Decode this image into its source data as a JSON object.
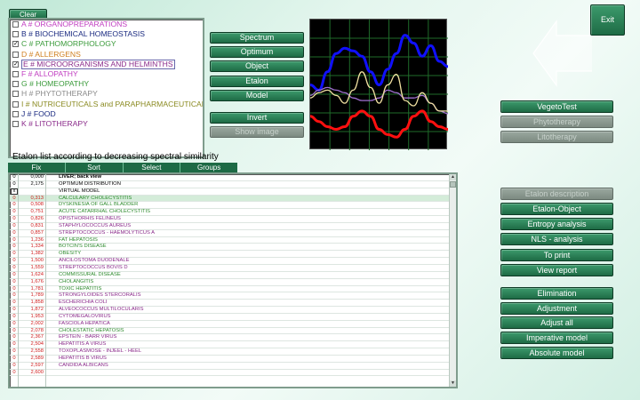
{
  "clear_label": "Clear",
  "exit_label": "Exit",
  "categories": [
    {
      "label": "A # ORGANOPREPARATIONS",
      "color": "#c03cc0",
      "checked": false
    },
    {
      "label": "B # BIOCHEMICAL HOMEOSTASIS",
      "color": "#1a2a80",
      "checked": false
    },
    {
      "label": "C # PATHOMORPHOLOGY",
      "color": "#3a9a3a",
      "checked": true
    },
    {
      "label": "D # ALLERGENS",
      "color": "#d08020",
      "checked": false
    },
    {
      "label": "E # MICROORGANISMS AND HELMINTHS",
      "color": "#8a2a8a",
      "checked": true
    },
    {
      "label": "F # ALLOPATHY",
      "color": "#c03cc0",
      "checked": false
    },
    {
      "label": "G # HOMEOPATHY",
      "color": "#3a9a3a",
      "checked": false
    },
    {
      "label": "H # PHYTOTHERAPY",
      "color": "#8a8a8a",
      "checked": false
    },
    {
      "label": "I # NUTRICEUTICALS and PARAPHARMACEUTICALS",
      "color": "#8a8a20",
      "checked": false
    },
    {
      "label": "J # FOOD",
      "color": "#1a2a80",
      "checked": false
    },
    {
      "label": "K # LITOTHERAPY",
      "color": "#8a2a8a",
      "checked": false
    }
  ],
  "middle_buttons": [
    {
      "name": "spectrum-button",
      "label": "Spectrum",
      "disabled": false
    },
    {
      "name": "optimum-button",
      "label": "Optimum",
      "disabled": false
    },
    {
      "name": "object-button",
      "label": "Object",
      "disabled": false
    },
    {
      "name": "etalon-button",
      "label": "Etalon",
      "disabled": false
    },
    {
      "name": "model-button",
      "label": "Model",
      "disabled": false
    },
    {
      "name": "invert-button",
      "label": "Invert",
      "disabled": false
    },
    {
      "name": "show-image-button",
      "label": "Show image",
      "disabled": true
    }
  ],
  "right_top_buttons": [
    {
      "name": "vegetotest-button",
      "label": "VegetoTest",
      "disabled": false
    },
    {
      "name": "phytotherapy-button",
      "label": "Phytotherapy",
      "disabled": true
    },
    {
      "name": "litotherapy-button",
      "label": "Litotherapy",
      "disabled": true
    }
  ],
  "right_mid_buttons": [
    {
      "name": "etalon-description-button",
      "label": "Etalon description",
      "disabled": true
    },
    {
      "name": "etalon-object-button",
      "label": "Etalon-Object",
      "disabled": false
    },
    {
      "name": "entropy-analysis-button",
      "label": "Entropy analysis",
      "disabled": false
    },
    {
      "name": "nls-analysis-button",
      "label": "NLS - analysis",
      "disabled": false
    },
    {
      "name": "to-print-button",
      "label": "To print",
      "disabled": false
    },
    {
      "name": "view-report-button",
      "label": "View report",
      "disabled": false
    }
  ],
  "right_bottom_buttons": [
    {
      "name": "elimination-button",
      "label": "Elimination",
      "disabled": false
    },
    {
      "name": "adjustment-button",
      "label": "Adjustment",
      "disabled": false
    },
    {
      "name": "adjust-all-button",
      "label": "Adjust all",
      "disabled": false
    },
    {
      "name": "imperative-model-button",
      "label": "Imperative model",
      "disabled": false
    },
    {
      "name": "absolute-model-button",
      "label": "Absolute model",
      "disabled": false
    }
  ],
  "list_title": "Etalon list according to decreasing spectral similarity",
  "list_toolbar": [
    "Fix",
    "Sort",
    "Select",
    "Groups"
  ],
  "list_rows": [
    {
      "chk": "0",
      "value": "0,000",
      "name": "LIVER; back view",
      "color": "#000000",
      "bold": true,
      "selected": false
    },
    {
      "chk": "0",
      "value": "2,175",
      "name": "OPTIMUM DISTRIBUTION",
      "color": "#000000",
      "bold": false,
      "selected": false
    },
    {
      "chk": "x",
      "value": "",
      "name": "VIRTUAL MODEL",
      "color": "#000000",
      "bold": false,
      "selected": false
    },
    {
      "chk": "0",
      "value": "0,313",
      "name": "CALCULARY CHOLECYSTITIS",
      "color": "#2e8b2e",
      "bold": false,
      "selected": true
    },
    {
      "chk": "0",
      "value": "0,508",
      "name": "DYSKINESIA OF GALL BLADDER",
      "color": "#2e8b2e",
      "bold": false,
      "selected": false
    },
    {
      "chk": "0",
      "value": "0,751",
      "name": "ACUTE CATARRHAL CHOLECYSTITIS",
      "color": "#2e8b2e",
      "bold": false,
      "selected": false
    },
    {
      "chk": "0",
      "value": "0,826",
      "name": "OPISTHORHIS FELINEUS",
      "color": "#8a2a8a",
      "bold": false,
      "selected": false
    },
    {
      "chk": "0",
      "value": "0,831",
      "name": "STAPHYLOCOCCUS AUREUS",
      "color": "#8a2a8a",
      "bold": false,
      "selected": false
    },
    {
      "chk": "0",
      "value": "0,857",
      "name": "STREPTOCOCCUS - HAEMOLYTICUS A",
      "color": "#8a2a8a",
      "bold": false,
      "selected": false
    },
    {
      "chk": "0",
      "value": "1,236",
      "name": "FAT HEPATOSIS",
      "color": "#2e8b2e",
      "bold": false,
      "selected": false
    },
    {
      "chk": "0",
      "value": "1,334",
      "name": "BOTCIN'S DISEASE",
      "color": "#2e8b2e",
      "bold": false,
      "selected": false
    },
    {
      "chk": "0",
      "value": "1,382",
      "name": "OBESITY",
      "color": "#2e8b2e",
      "bold": false,
      "selected": false
    },
    {
      "chk": "0",
      "value": "1,500",
      "name": "ANCILOSTOMA DUODENALE",
      "color": "#8a2a8a",
      "bold": false,
      "selected": false
    },
    {
      "chk": "0",
      "value": "1,559",
      "name": "STREPTOCOCCUS BOVIS D",
      "color": "#8a2a8a",
      "bold": false,
      "selected": false
    },
    {
      "chk": "0",
      "value": "1,624",
      "name": "COMMISSURAL DISEASE",
      "color": "#2e8b2e",
      "bold": false,
      "selected": false
    },
    {
      "chk": "0",
      "value": "1,676",
      "name": "CHOLANGITIS",
      "color": "#2e8b2e",
      "bold": false,
      "selected": false
    },
    {
      "chk": "0",
      "value": "1,781",
      "name": "TOXIC HEPATITIS",
      "color": "#2e8b2e",
      "bold": false,
      "selected": false
    },
    {
      "chk": "0",
      "value": "1,789",
      "name": "STRONGYLOIDES STERCORALIS",
      "color": "#8a2a8a",
      "bold": false,
      "selected": false
    },
    {
      "chk": "0",
      "value": "1,858",
      "name": "ESCHERICHIA COLI",
      "color": "#8a2a8a",
      "bold": false,
      "selected": false
    },
    {
      "chk": "0",
      "value": "1,872",
      "name": "ALVEOCOCCUS MULTILOCULARIS",
      "color": "#8a2a8a",
      "bold": false,
      "selected": false
    },
    {
      "chk": "0",
      "value": "1,953",
      "name": "CYTOMEGALOVIRUS",
      "color": "#8a2a8a",
      "bold": false,
      "selected": false
    },
    {
      "chk": "0",
      "value": "2,002",
      "name": "FASCIOLA HEPATICA",
      "color": "#8a2a8a",
      "bold": false,
      "selected": false
    },
    {
      "chk": "0",
      "value": "2,078",
      "name": "CHOLESTATIC HEPATOSIS",
      "color": "#2e8b2e",
      "bold": false,
      "selected": false
    },
    {
      "chk": "0",
      "value": "2,367",
      "name": "EPSTEIN - BARR VIRUS",
      "color": "#8a2a8a",
      "bold": false,
      "selected": false
    },
    {
      "chk": "0",
      "value": "2,504",
      "name": "HEPATITIS A VIRUS",
      "color": "#8a2a8a",
      "bold": false,
      "selected": false
    },
    {
      "chk": "0",
      "value": "2,558",
      "name": "TOXOPLASMOSE - INJEEL - HEEL",
      "color": "#8a2a8a",
      "bold": false,
      "selected": false
    },
    {
      "chk": "0",
      "value": "2,589",
      "name": "HEPATITIS B VIRUS",
      "color": "#8a2a8a",
      "bold": false,
      "selected": false
    },
    {
      "chk": "0",
      "value": "2,597",
      "name": "CANDIDA ALBICANS",
      "color": "#8a2a8a",
      "bold": false,
      "selected": false
    },
    {
      "chk": "0",
      "value": "2,600",
      "name": "",
      "color": "#8a2a8a",
      "bold": false,
      "selected": false
    }
  ],
  "chart": {
    "background": "#000000",
    "grid_color": "#1f6b2a",
    "series": [
      {
        "color": "#1010ff",
        "values": [
          0.5,
          0.46,
          0.6,
          0.74,
          0.78,
          0.76,
          0.72,
          0.6,
          0.5,
          0.62,
          0.74,
          0.88,
          0.82,
          0.72,
          0.8,
          0.68,
          0.64
        ]
      },
      {
        "color": "#a070d0",
        "values": [
          0.42,
          0.46,
          0.48,
          0.46,
          0.44,
          0.4,
          0.38,
          0.38,
          0.4,
          0.46,
          0.44,
          0.4,
          0.4,
          0.42,
          0.36,
          0.3,
          0.28
        ]
      },
      {
        "color": "#f0e0a0",
        "values": [
          0.4,
          0.44,
          0.46,
          0.42,
          0.36,
          0.46,
          0.6,
          0.48,
          0.36,
          0.5,
          0.58,
          0.38,
          0.34,
          0.44,
          0.36,
          0.3,
          0.3
        ]
      },
      {
        "color": "#ff1010",
        "values": [
          0.26,
          0.22,
          0.18,
          0.16,
          0.18,
          0.26,
          0.3,
          0.26,
          0.16,
          0.12,
          0.1,
          0.16,
          0.26,
          0.3,
          0.22,
          0.18,
          0.16
        ]
      }
    ]
  }
}
